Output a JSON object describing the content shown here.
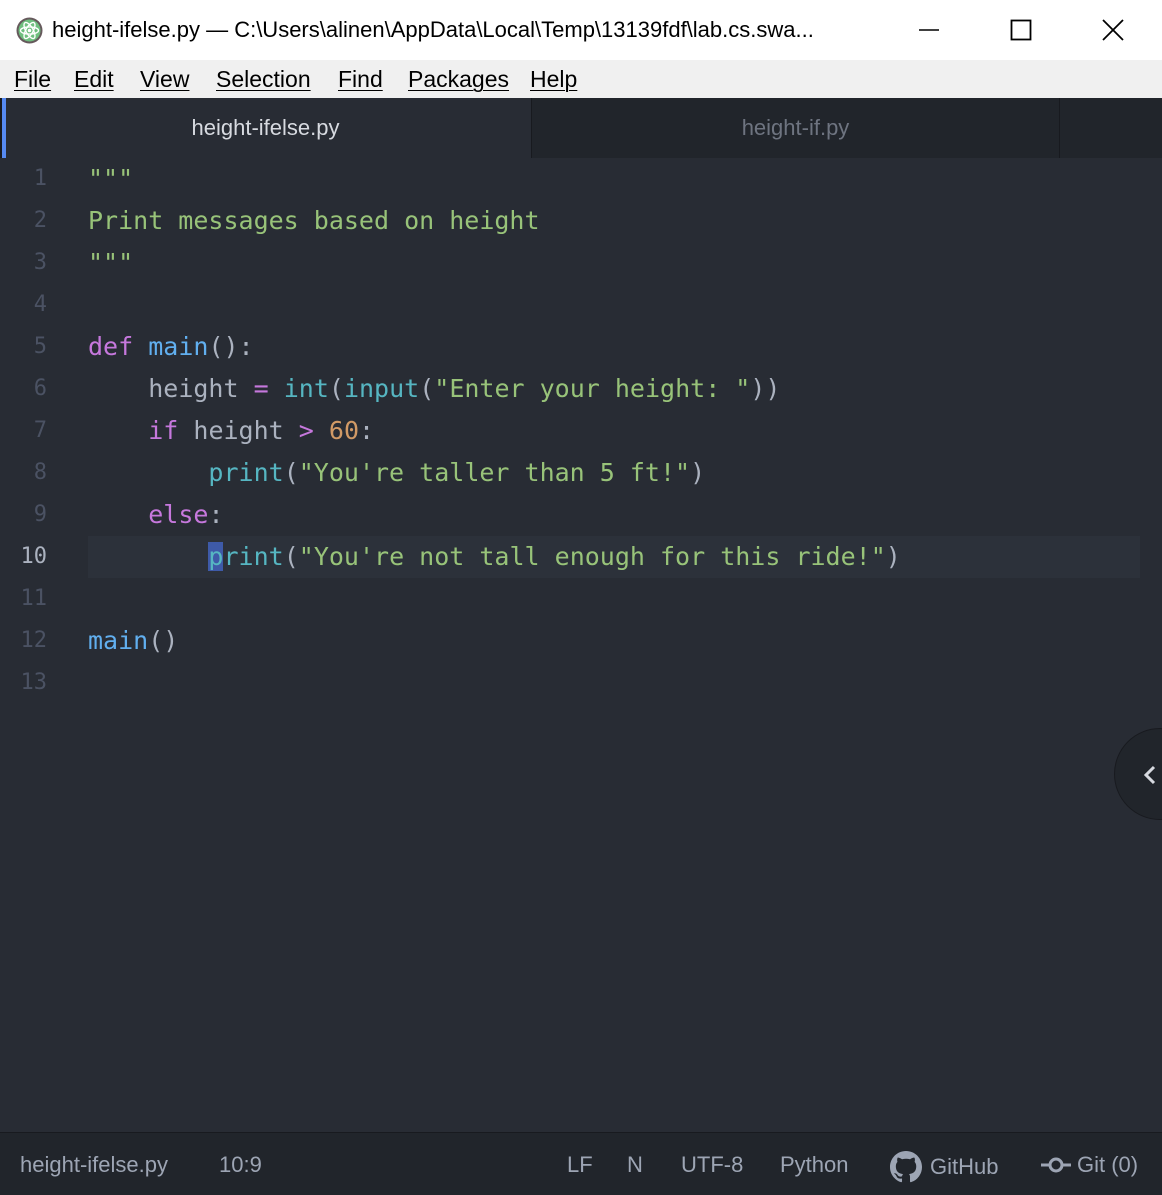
{
  "window": {
    "title": "height-ifelse.py — C:\\Users\\alinen\\AppData\\Local\\Temp\\13139fdf\\lab.cs.swa...",
    "app_icon": "atom-icon"
  },
  "menu": [
    "File",
    "Edit",
    "View",
    "Selection",
    "Find",
    "Packages",
    "Help"
  ],
  "tabs": [
    {
      "label": "height-ifelse.py",
      "active": true
    },
    {
      "label": "height-if.py",
      "active": false
    }
  ],
  "editor": {
    "line_numbers": [
      "1",
      "2",
      "3",
      "4",
      "5",
      "6",
      "7",
      "8",
      "9",
      "10",
      "11",
      "12",
      "13"
    ],
    "current_line": "10",
    "lines": [
      "\"\"\"",
      "Print messages based on height",
      "\"\"\"",
      "",
      "def main():",
      "    height = int(input(\"Enter your height: \"))",
      "    if height > 60:",
      "        print(\"You're taller than 5 ft!\")",
      "    else:",
      "        print(\"You're not tall enough for this ride!\")",
      "",
      "main()",
      ""
    ]
  },
  "status": {
    "file": "height-ifelse.py",
    "cursor": "10:9",
    "line_ending": "LF",
    "n": "N",
    "encoding": "UTF-8",
    "grammar": "Python",
    "github": "GitHub",
    "git": "Git (0)"
  },
  "colors": {
    "keyword": "#c678dd",
    "function": "#61afef",
    "builtin": "#56b6c2",
    "string": "#98c379",
    "number": "#d19a66",
    "accent": "#568af2"
  }
}
